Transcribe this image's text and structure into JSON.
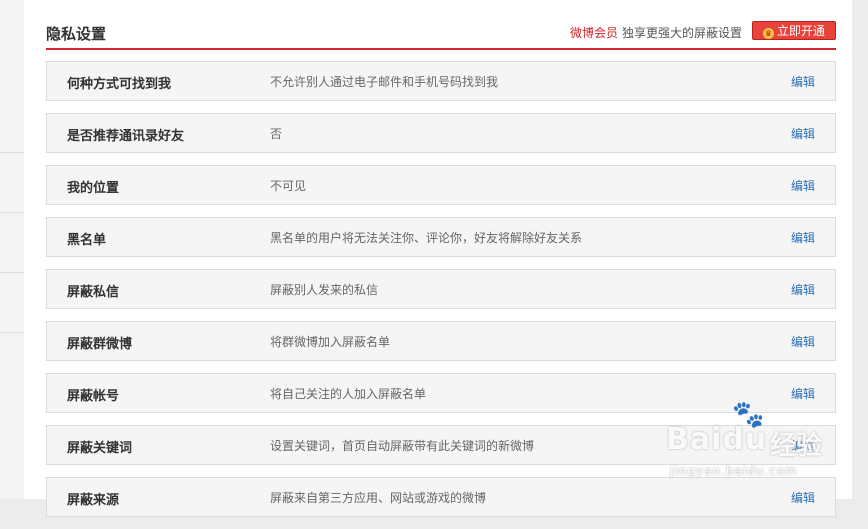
{
  "header": {
    "title": "隐私设置",
    "vip_link": "微博会员",
    "promo_text": "独享更强大的屏蔽设置",
    "open_button": "立即开通",
    "accent_color": "#d0262d"
  },
  "rows": [
    {
      "label": "何种方式可找到我",
      "desc": "不允许别人通过电子邮件和手机号码找到我",
      "action": "编辑"
    },
    {
      "label": "是否推荐通讯录好友",
      "desc": "否",
      "action": "编辑"
    },
    {
      "label": "我的位置",
      "desc": "不可见",
      "action": "编辑"
    },
    {
      "label": "黑名单",
      "desc": "黑名单的用户将无法关注你、评论你，好友将解除好友关系",
      "action": "编辑"
    },
    {
      "label": "屏蔽私信",
      "desc": "屏蔽别人发来的私信",
      "action": "编辑"
    },
    {
      "label": "屏蔽群微博",
      "desc": "将群微博加入屏蔽名单",
      "action": "编辑"
    },
    {
      "label": "屏蔽帐号",
      "desc": "将自己关注的人加入屏蔽名单",
      "action": "编辑"
    },
    {
      "label": "屏蔽关键词",
      "desc": "设置关键词，首页自动屏蔽带有此关键词的新微博",
      "action": "编辑"
    },
    {
      "label": "屏蔽来源",
      "desc": "屏蔽来自第三方应用、网站或游戏的微博",
      "action": "编辑"
    }
  ],
  "watermark": {
    "brand": "Baidu",
    "cn": "经验",
    "url": "jingyan.baidu.com"
  }
}
